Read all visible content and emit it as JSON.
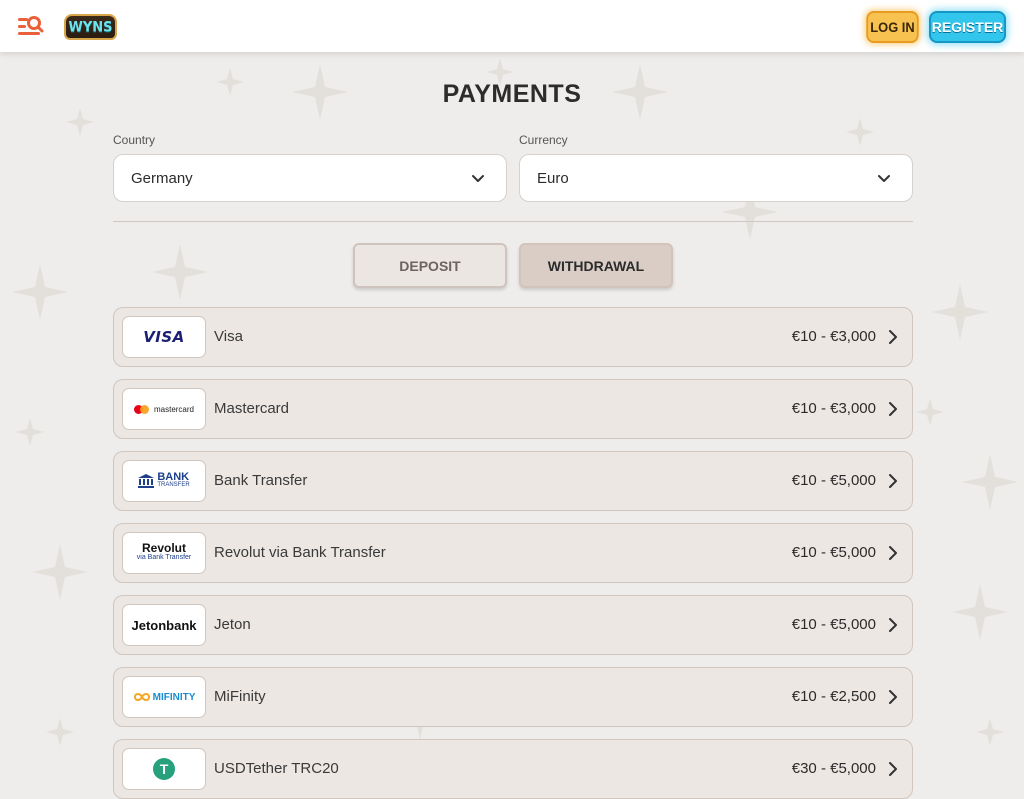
{
  "header": {
    "logo_text": "WYNS",
    "login_label": "LOG IN",
    "register_label": "REGISTER"
  },
  "page": {
    "title": "PAYMENTS",
    "country": {
      "label": "Country",
      "value": "Germany"
    },
    "currency": {
      "label": "Currency",
      "value": "Euro"
    },
    "tabs": {
      "deposit": "DEPOSIT",
      "withdrawal": "WITHDRAWAL"
    }
  },
  "payments": [
    {
      "name": "Visa",
      "range": "€10 - €3,000",
      "logo": "VISA"
    },
    {
      "name": "Mastercard",
      "range": "€10 - €3,000",
      "logo": "mastercard"
    },
    {
      "name": "Bank Transfer",
      "range": "€10 - €5,000",
      "logo": "BANK",
      "logo_sub": "TRANSFER"
    },
    {
      "name": "Revolut via Bank Transfer",
      "range": "€10 - €5,000",
      "logo": "Revolut",
      "logo_sub": "via Bank Transfer"
    },
    {
      "name": "Jeton",
      "range": "€10 - €5,000",
      "logo": "Jetonbank"
    },
    {
      "name": "MiFinity",
      "range": "€10 - €2,500",
      "logo": "MIFINITY"
    },
    {
      "name": "USDTether TRC20",
      "range": "€30 - €5,000",
      "logo": "T"
    }
  ],
  "colors": {
    "accent_login": "#f7c24f",
    "accent_register": "#33c6ec",
    "menu_icon": "#e8613a"
  }
}
